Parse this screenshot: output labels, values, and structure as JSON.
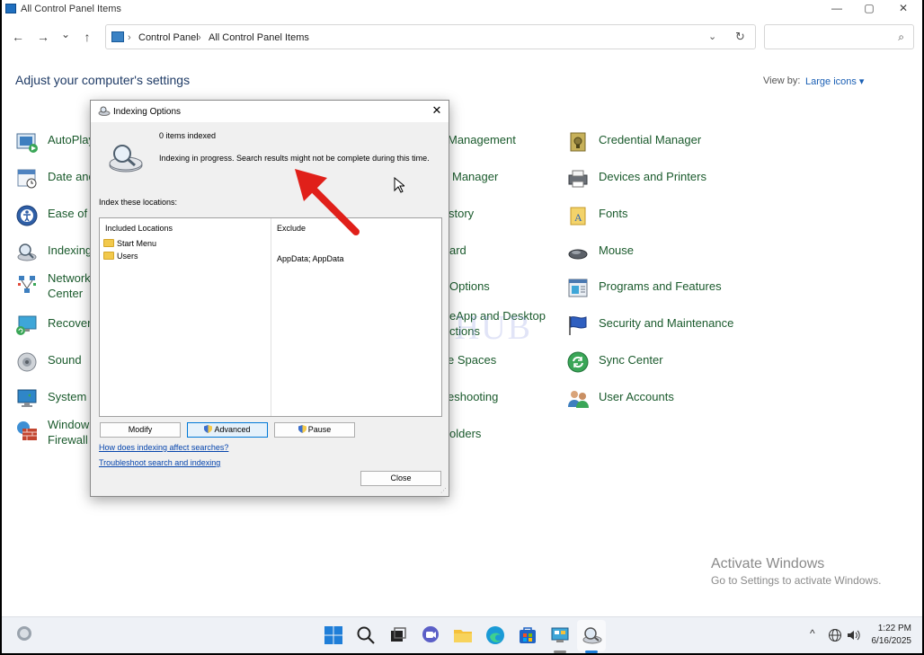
{
  "window": {
    "title": "All Control Panel Items",
    "minimize": "—",
    "maximize": "▢",
    "close": "✕"
  },
  "nav": {
    "back": "←",
    "forward": "→",
    "recent": "⌄",
    "up": "↑",
    "breadcrumb": [
      "Control Panel",
      "All Control Panel Items"
    ],
    "separator": "›",
    "dropdown": "⌄",
    "refresh": "↻",
    "search_placeholder": "",
    "search_icon": "⌕"
  },
  "header": {
    "title": "Adjust your computer's settings",
    "view_by_label": "View by:",
    "view_by_value": "Large icons ▾"
  },
  "items_col1": [
    "AutoPlay",
    "Date and",
    "Ease of A",
    "Indexing",
    "Network",
    "Center",
    "Recovery",
    "Sound",
    "System",
    "Window",
    "Firewall"
  ],
  "items_col2": [
    "Management",
    "Manager",
    "story",
    "ard",
    "Options",
    "eApp and Desktop",
    "ctions",
    "e Spaces",
    "eshooting",
    "olders"
  ],
  "items_col3": [
    "Credential Manager",
    "Devices and Printers",
    "Fonts",
    "Mouse",
    "Programs and Features",
    "Security and Maintenance",
    "Sync Center",
    "User Accounts"
  ],
  "dialog": {
    "title": "Indexing Options",
    "close": "✕",
    "items_indexed": "0 items indexed",
    "status": "Indexing in progress. Search results might not be complete during this time.",
    "locations_label": "Index these locations:",
    "col_included": "Included Locations",
    "col_exclude": "Exclude",
    "locations": [
      "Start Menu",
      "Users"
    ],
    "users_exclude": "AppData; AppData",
    "btn_modify": "Modify",
    "btn_advanced": "Advanced",
    "btn_pause": "Pause",
    "link_how": "How does indexing affect searches?",
    "link_troubleshoot": "Troubleshoot search and indexing",
    "btn_close": "Close"
  },
  "watermark": "IT Pros HUB",
  "activation": {
    "title": "Activate Windows",
    "subtitle": "Go to Settings to activate Windows."
  },
  "taskbar": {
    "time": "1:22 PM",
    "date": "6/16/2025",
    "tray_chevron": "^"
  },
  "colors": {
    "link_green": "#1a5a2c",
    "arrow": "#e0201a",
    "accent": "#0078d7"
  }
}
